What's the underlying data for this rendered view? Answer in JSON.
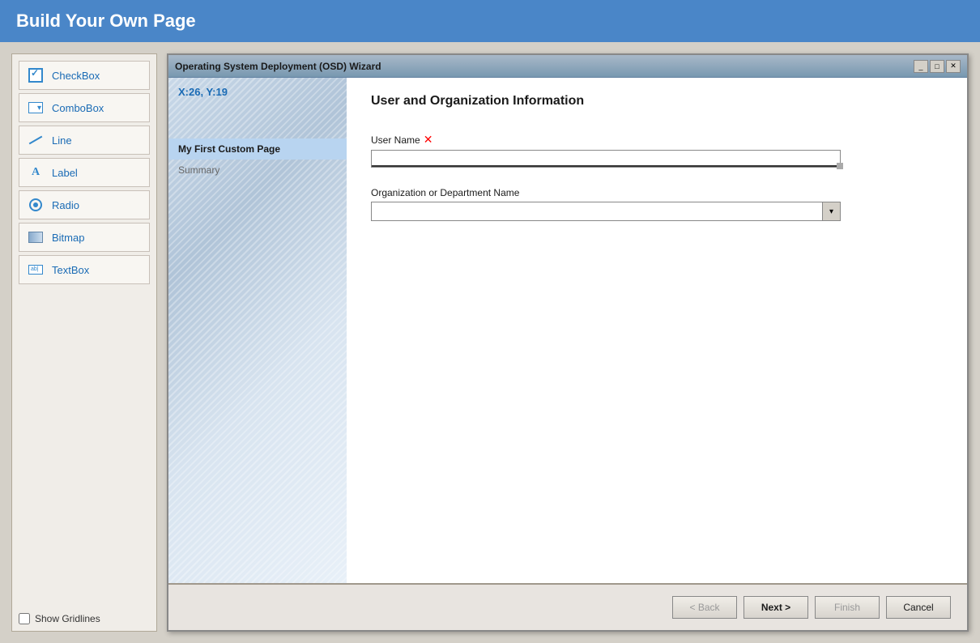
{
  "header": {
    "title": "Build Your Own Page"
  },
  "toolbar": {
    "items": [
      {
        "id": "checkbox",
        "label": "CheckBox",
        "icon": "checkbox-icon"
      },
      {
        "id": "combobox",
        "label": "ComboBox",
        "icon": "combobox-icon"
      },
      {
        "id": "line",
        "label": "Line",
        "icon": "line-icon"
      },
      {
        "id": "label",
        "label": "Label",
        "icon": "label-icon"
      },
      {
        "id": "radio",
        "label": "Radio",
        "icon": "radio-icon"
      },
      {
        "id": "bitmap",
        "label": "Bitmap",
        "icon": "bitmap-icon"
      },
      {
        "id": "textbox",
        "label": "TextBox",
        "icon": "textbox-icon"
      }
    ],
    "show_gridlines_label": "Show Gridlines"
  },
  "wizard": {
    "title": "Operating System Deployment (OSD) Wizard",
    "coordinates": "X:26, Y:19",
    "nav_items": [
      {
        "id": "custom-page",
        "label": "My First Custom Page",
        "active": true
      },
      {
        "id": "summary",
        "label": "Summary",
        "active": false
      }
    ],
    "content": {
      "title": "User and Organization Information",
      "fields": [
        {
          "id": "user-name",
          "label": "User Name",
          "type": "textbox",
          "required": true,
          "value": ""
        },
        {
          "id": "org-name",
          "label": "Organization or Department Name",
          "type": "combobox",
          "required": false,
          "value": ""
        }
      ]
    },
    "footer": {
      "back_label": "< Back",
      "next_label": "Next >",
      "finish_label": "Finish",
      "cancel_label": "Cancel"
    },
    "titlebar_buttons": [
      "_",
      "□",
      "✕"
    ]
  }
}
